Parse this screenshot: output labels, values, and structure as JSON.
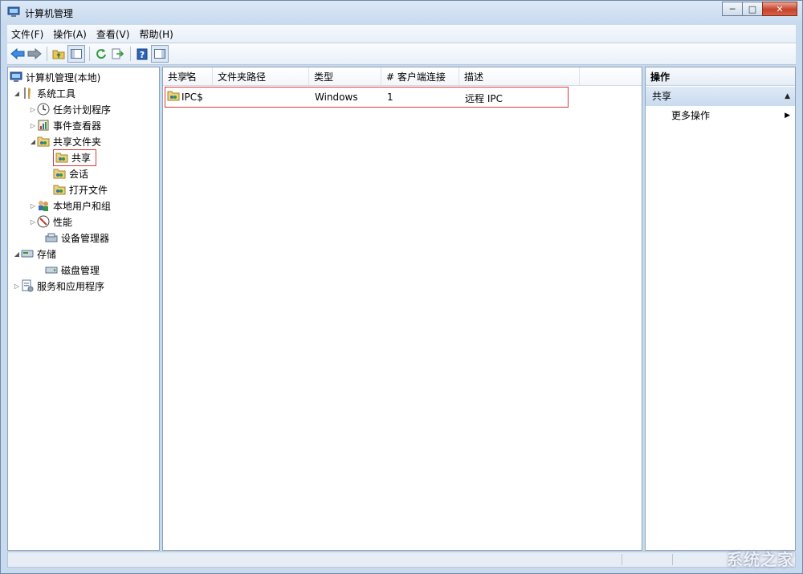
{
  "window": {
    "title": "计算机管理",
    "buttons": {
      "minimize": "─",
      "maximize": "□",
      "close": "✕"
    }
  },
  "menu": [
    "文件(F)",
    "操作(A)",
    "查看(V)",
    "帮助(H)"
  ],
  "toolbar": [
    "back-icon",
    "forward-icon",
    "up-folder-icon",
    "show-hide-console-tree-icon",
    "refresh-icon",
    "export-list-icon",
    "help-icon",
    "show-hide-action-pane-icon"
  ],
  "tree": {
    "root": "计算机管理(本地)",
    "items": [
      {
        "label": "系统工具"
      },
      {
        "label": "任务计划程序"
      },
      {
        "label": "事件查看器"
      },
      {
        "label": "共享文件夹"
      },
      {
        "label": "共享"
      },
      {
        "label": "会话"
      },
      {
        "label": "打开文件"
      },
      {
        "label": "本地用户和组"
      },
      {
        "label": "性能"
      },
      {
        "label": "设备管理器"
      },
      {
        "label": "存储"
      },
      {
        "label": "磁盘管理"
      },
      {
        "label": "服务和应用程序"
      }
    ]
  },
  "list": {
    "columns": [
      "共享名",
      "文件夹路径",
      "类型",
      "# 客户端连接",
      "描述"
    ],
    "rows": [
      {
        "name": "IPC$",
        "path": "",
        "type": "Windows",
        "clients": "1",
        "desc": "远程 IPC"
      }
    ]
  },
  "actions": {
    "title": "操作",
    "section": "共享",
    "items": [
      "更多操作"
    ]
  },
  "watermark": "系统之家"
}
